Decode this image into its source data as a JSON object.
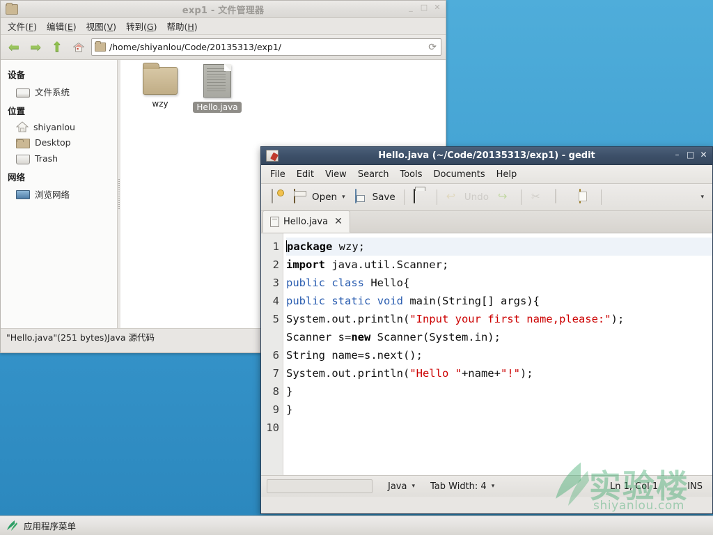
{
  "desktop": {
    "background_top": "#4fadda",
    "background_bottom": "#2b87bd"
  },
  "filemanager": {
    "title": "exp1 - 文件管理器",
    "titlebar_icon": "folder-icon",
    "window_buttons": {
      "minimize": "_",
      "maximize": "□",
      "close": "✕"
    },
    "menus": [
      {
        "label": "文件(F)",
        "text": "文件(",
        "key": "F",
        "tail": ")"
      },
      {
        "label": "编辑(E)",
        "text": "编辑(",
        "key": "E",
        "tail": ")"
      },
      {
        "label": "视图(V)",
        "text": "视图(",
        "key": "V",
        "tail": ")"
      },
      {
        "label": "转到(G)",
        "text": "转到(",
        "key": "G",
        "tail": ")"
      },
      {
        "label": "帮助(H)",
        "text": "帮助(",
        "key": "H",
        "tail": ")"
      }
    ],
    "toolbar": {
      "back_icon": "back-arrow-icon",
      "forward_icon": "forward-arrow-icon",
      "up_icon": "up-arrow-icon",
      "home_icon": "home-icon",
      "reload_icon": "reload-icon",
      "reload_glyph": "⟳"
    },
    "path": "/home/shiyanlou/Code/20135313/exp1/",
    "sidebar": {
      "groups": [
        {
          "label": "设备",
          "items": [
            {
              "label": "文件系统",
              "icon": "drive-icon"
            }
          ]
        },
        {
          "label": "位置",
          "items": [
            {
              "label": "shiyanlou",
              "icon": "home-icon"
            },
            {
              "label": "Desktop",
              "icon": "folder-icon"
            },
            {
              "label": "Trash",
              "icon": "trash-icon"
            }
          ]
        },
        {
          "label": "网络",
          "items": [
            {
              "label": "浏览网络",
              "icon": "network-icon"
            }
          ]
        }
      ]
    },
    "files": [
      {
        "name": "wzy",
        "type": "folder",
        "selected": false
      },
      {
        "name": "Hello.java",
        "type": "document",
        "selected": true
      }
    ],
    "statusbar": "\"Hello.java\"(251 bytes)Java 源代码"
  },
  "gedit": {
    "title": "Hello.java (~/Code/20135313/exp1) - gedit",
    "titlebar_icon": "gedit-icon",
    "window_buttons": {
      "minimize": "–",
      "maximize": "□",
      "close": "✕"
    },
    "menus": [
      "File",
      "Edit",
      "View",
      "Search",
      "Tools",
      "Documents",
      "Help"
    ],
    "toolbar": {
      "new_label": "",
      "new_icon": "new-document-icon",
      "open_label": "Open",
      "open_icon": "open-folder-icon",
      "open_caret": "▾",
      "save_label": "Save",
      "save_icon": "save-icon",
      "print_icon": "print-icon",
      "undo_label": "Undo",
      "undo_icon": "undo-icon",
      "redo_icon": "redo-icon",
      "cut_icon": "cut-icon",
      "copy_icon": "copy-icon",
      "paste_icon": "paste-icon",
      "overflow_caret": "▾"
    },
    "tab": {
      "label": "Hello.java",
      "icon": "document-icon",
      "close": "✕"
    },
    "editor": {
      "line_numbers": [
        "1",
        "2",
        "3",
        "4",
        "5",
        "",
        "6",
        "7",
        "8",
        "9",
        "10"
      ],
      "lines": [
        "package wzy;",
        "import java.util.Scanner;",
        "public class Hello{",
        "public static void main(String[] args){",
        "System.out.println(\"Input your first name,please:\");",
        "Scanner s=new Scanner(System.in);",
        "String name=s.next();",
        "System.out.println(\"Hello \"+name+\"!\");",
        "}",
        "}"
      ]
    },
    "statusbar": {
      "language": "Java",
      "language_caret": "▾",
      "tab_width": "Tab Width: 4",
      "tab_width_caret": "▾",
      "position": "Ln 1, Col 1",
      "insert_mode": "INS"
    }
  },
  "watermark": {
    "cn": "实验楼",
    "en": "shiyanlou.com",
    "color": "#3aa868"
  },
  "taskbar": {
    "start_label": "应用程序菜单",
    "start_icon": "shiyanlou-leaf-icon"
  }
}
